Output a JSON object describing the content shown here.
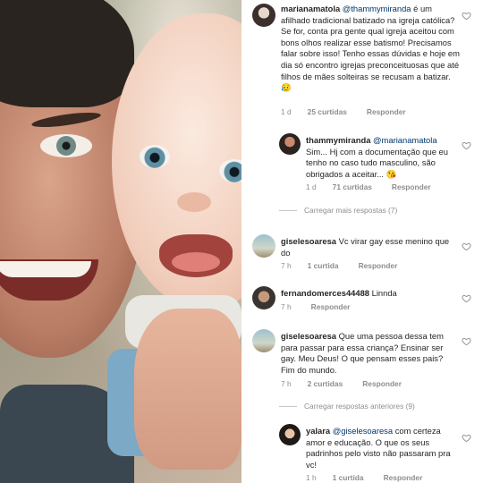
{
  "photo": {
    "description_icon": "photo"
  },
  "comments": [
    {
      "username": "marianamatola",
      "mention": "@thammymiranda",
      "body": " é um afilhado tradicional batizado na igreja católica? Se for, conta pra gente qual igreja aceitou com bons olhos realizar esse batismo! Precisamos falar sobre isso! Tenho essas dúvidas e hoje em dia só encontro igrejas preconceituosas que até filhos de mães solteiras se recusam a batizar. ",
      "emoji": "😥",
      "time": "1 d",
      "likes": "25 curtidas",
      "reply": "Responder"
    },
    {
      "username": "thammymiranda",
      "mention": "@marianamatola",
      "body": " Sim... Hj com a documentação que eu tenho no caso tudo masculino, são obrigados a aceitar... ",
      "emoji": "😘",
      "time": "1 d",
      "likes": "71 curtidas",
      "reply": "Responder"
    },
    {
      "username": "giselesoaresa",
      "mention": "",
      "body": " Vc virar gay esse menino que do",
      "time": "7 h",
      "likes": "1 curtida",
      "reply": "Responder"
    },
    {
      "username": "fernandomerces44488",
      "mention": "",
      "body": " Linnda",
      "time": "7 h",
      "likes": "",
      "reply": "Responder"
    },
    {
      "username": "giselesoaresa",
      "mention": "",
      "body": " Que uma pessoa dessa tem para passar para essa criança? Ensinar ser gay. Meu Deus! O que pensam esses pais? Fim do mundo.",
      "time": "7 h",
      "likes": "2 curtidas",
      "reply": "Responder"
    },
    {
      "username": "yalara",
      "mention": "@giselesoaresa",
      "body": " com certeza amor e educação. O que os seus padrinhos pelo visto não passaram pra vc!",
      "time": "1 h",
      "likes": "1 curtida",
      "reply": "Responder"
    }
  ],
  "load_more_1": "Carregar mais respostas (7)",
  "load_more_2": "Carregar respostas anteriores (9)",
  "colors": {
    "text": "#262626",
    "meta": "#8e8e8e",
    "mention": "#00376b"
  },
  "icons": {
    "like": "heart-icon"
  }
}
